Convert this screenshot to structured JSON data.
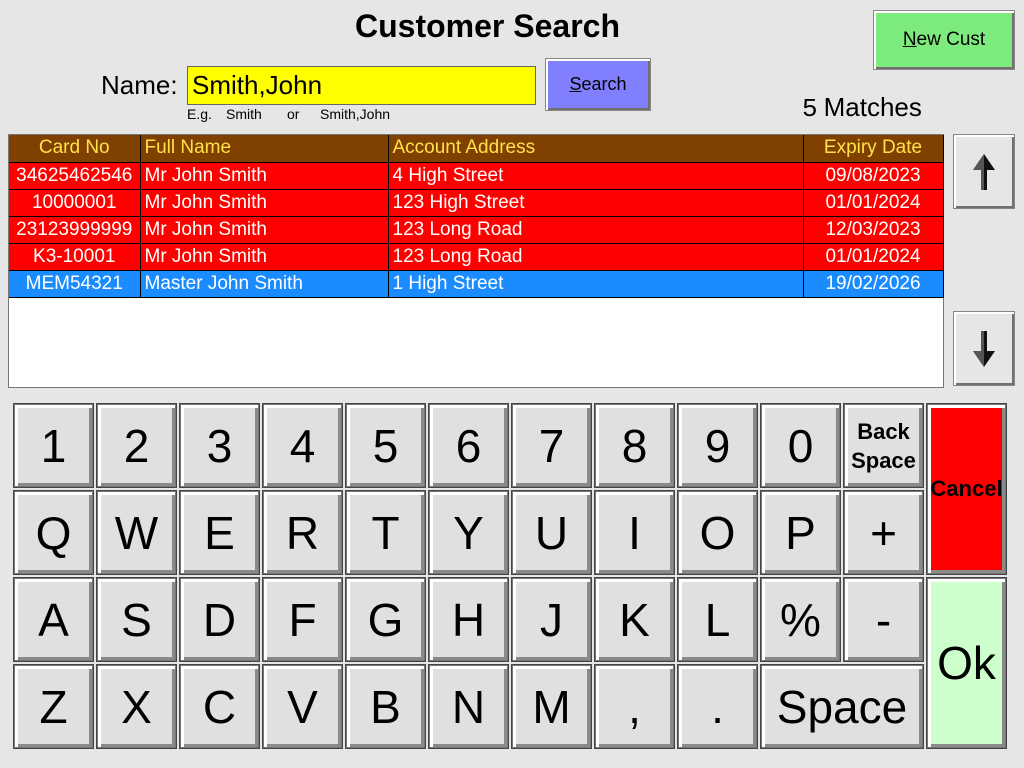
{
  "title": "Customer Search",
  "new_cust_label": "New Cust",
  "new_cust_accel": "N",
  "new_cust_rest": "ew Cust",
  "name_label": "Name:",
  "name_value": "Smith,John",
  "hint": {
    "eg": "E.g.",
    "ex1": "Smith",
    "or": "or",
    "ex2": "Smith,John"
  },
  "search_label": "Search",
  "search_accel": "S",
  "search_rest": "earch",
  "matches": {
    "count": "5",
    "label": "Matches"
  },
  "table": {
    "headers": [
      "Card No",
      "Full Name",
      "Account Address",
      "Expiry Date"
    ],
    "rows": [
      [
        "34625462546",
        "Mr John Smith",
        "4 High Street",
        "09/08/2023"
      ],
      [
        "10000001",
        "Mr John Smith",
        "123 High Street",
        "01/01/2024"
      ],
      [
        "23123999999",
        "Mr John Smith",
        "123 Long Road",
        "12/03/2023"
      ],
      [
        "K3-10001",
        "Mr John Smith",
        "123 Long Road",
        "01/01/2024"
      ],
      [
        "MEM54321",
        "Master John Smith",
        "1 High Street",
        "19/02/2026"
      ]
    ],
    "selected_row": 4
  },
  "scroll": {
    "up_icon": "arrow-up-icon",
    "down_icon": "arrow-down-icon"
  },
  "keyboard": {
    "row1": [
      "1",
      "2",
      "3",
      "4",
      "5",
      "6",
      "7",
      "8",
      "9",
      "0"
    ],
    "row2": [
      "Q",
      "W",
      "E",
      "R",
      "T",
      "Y",
      "U",
      "I",
      "O",
      "P",
      "+"
    ],
    "row3": [
      "A",
      "S",
      "D",
      "F",
      "G",
      "H",
      "J",
      "K",
      "L",
      "%",
      "-"
    ],
    "row4": [
      "Z",
      "X",
      "C",
      "V",
      "B",
      "N",
      "M",
      ",",
      "."
    ],
    "backspace_line1": "Back",
    "backspace_line2": "Space",
    "space": "Space",
    "cancel": "Cancel",
    "ok": "Ok"
  },
  "colors": {
    "name_field": "#ffff00",
    "search_button": "#8080ff",
    "new_cust_button": "#7dea7d",
    "header_bg": "#804000",
    "header_text": "#ffe24a",
    "row_bg": "#ff0000",
    "selected_row_bg": "#1a8cff",
    "cancel_bg": "#ff0000",
    "ok_bg": "#ccffcc"
  }
}
